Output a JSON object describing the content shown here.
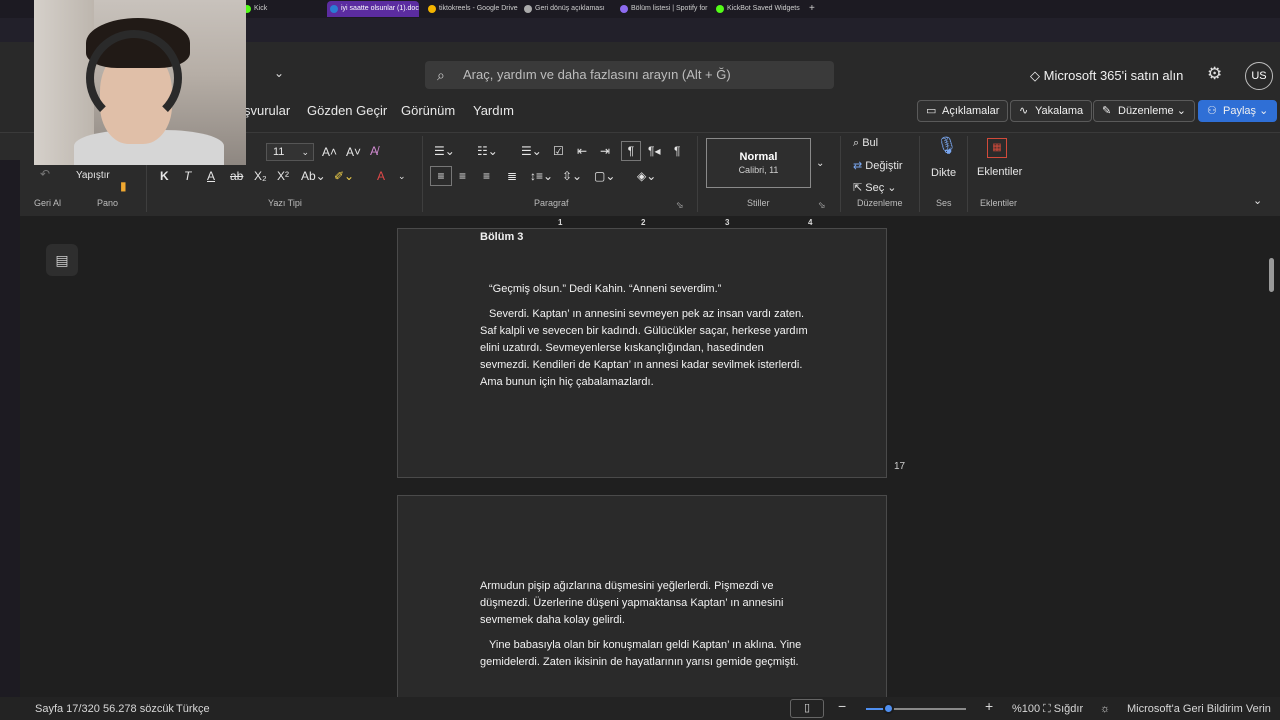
{
  "browser": {
    "tabs": [
      {
        "label": "Kick",
        "color": "#53fc18"
      },
      {
        "label": "iyi saatte olsunlar (1).doc",
        "color": "#2b7cd3",
        "active": true
      },
      {
        "label": "tiktokreels - Google Drive",
        "color": "#f4b400"
      },
      {
        "label": "Geri dönüş açıklaması",
        "color": "#aaaaaa"
      },
      {
        "label": "Bölüm listesi | Spotify for",
        "color": "#8d6bf0"
      },
      {
        "label": "KickBot Saved Widgets",
        "color": "#53fc18"
      }
    ],
    "new_tab": "+"
  },
  "header": {
    "search_placeholder": "Araç, yardım ve daha fazlasını arayın (Alt + Ğ)",
    "buy_label": "Microsoft 365'i satın alın",
    "avatar_initials": "US",
    "menu": [
      "şvurular",
      "Gözden Geçir",
      "Görünüm",
      "Yardım"
    ],
    "buttons": {
      "comments": "Açıklamalar",
      "catchup": "Yakalama",
      "editing": "Düzenleme",
      "share": "Paylaş"
    }
  },
  "ribbon": {
    "undo_label": "Geri Al",
    "paste_label": "Yapıştır",
    "clipboard_label": "Pano",
    "font_size": "11",
    "font_label": "Yazı Tipi",
    "paragraph_label": "Paragraf",
    "style_name": "Normal",
    "style_font": "Calibri, 11",
    "styles_label": "Stiller",
    "find_label": "Bul",
    "replace_label": "Değiştir",
    "select_label": "Seç",
    "editing_label": "Düzenleme",
    "dictate_label": "Dikte",
    "voice_label": "Ses",
    "addins_label": "Eklentiler",
    "addins_group_label": "Eklentiler"
  },
  "ruler": [
    "1",
    "2",
    "3",
    "4"
  ],
  "document": {
    "page1": {
      "heading": "Bölüm 3",
      "p1": "“Geçmiş olsun.” Dedi Kahin. “Anneni severdim.”",
      "p2": "Severdi. Kaptan’ ın annesini sevmeyen pek az insan vardı zaten. Saf kalpli ve sevecen bir kadındı. Gülücükler saçar, herkese yardım elini uzatırdı. Sevmeyenlerse kıskançlığından, hasedinden sevmezdi. Kendileri de Kaptan’ ın annesi kadar sevilmek isterlerdi. Ama bunun için hiç çabalamazlardı.",
      "page_number": "17"
    },
    "page2": {
      "p1": "Armudun pişip ağızlarına düşmesini yeğlerlerdi. Pişmezdi ve düşmezdi. Üzerlerine düşeni yapmaktansa Kaptan’ ın annesini sevmemek daha kolay gelirdi.",
      "p2": "Yine babasıyla olan bir konuşmaları geldi Kaptan’ ın aklına. Yine gemidelerdi. Zaten ikisinin de hayatlarının yarısı gemide geçmişti."
    }
  },
  "status": {
    "page": "Sayfa 17/320",
    "words": "56.278 sözcük",
    "language": "Türkçe",
    "zoom": "%100",
    "zoom_fraction": 0.23,
    "fit": "Sığdır",
    "feedback": "Microsoft'a Geri Bildirim Verin"
  }
}
